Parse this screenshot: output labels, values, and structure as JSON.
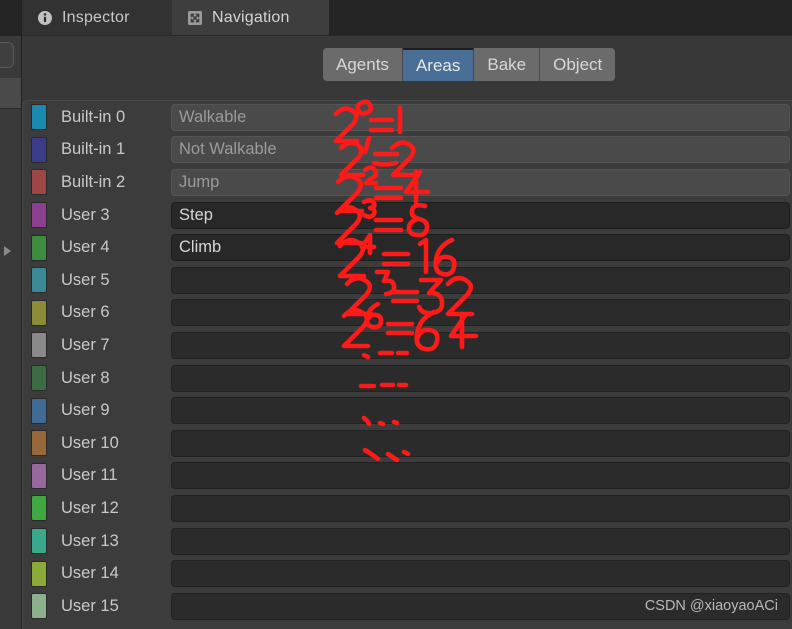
{
  "window": {
    "background_color": "#383838",
    "panel_color": "#3c3c3c"
  },
  "tabs": [
    {
      "label": "Inspector",
      "icon": "info-icon",
      "active": false
    },
    {
      "label": "Navigation",
      "icon": "move-arrows-icon",
      "active": true
    }
  ],
  "toolbar": {
    "buttons": [
      {
        "label": "Agents",
        "active": false
      },
      {
        "label": "Areas",
        "active": true
      },
      {
        "label": "Bake",
        "active": false
      },
      {
        "label": "Object",
        "active": false
      }
    ],
    "active_color": "#4a6f96",
    "inactive_color": "#6b6b6b"
  },
  "areas": [
    {
      "name": "Built-in 0",
      "color": "#1b8ab0",
      "value": "Walkable",
      "editable": false,
      "note": "2⁰ = 1"
    },
    {
      "name": "Built-in 1",
      "color": "#3c3c8c",
      "value": "Not Walkable",
      "editable": false,
      "note": "2¹ = 2"
    },
    {
      "name": "Built-in 2",
      "color": "#9c4646",
      "value": "Jump",
      "editable": false,
      "note": "2² = 4"
    },
    {
      "name": "User 3",
      "color": "#8c3f8c",
      "value": "Step",
      "editable": true,
      "note": "2³ = 8"
    },
    {
      "name": "User 4",
      "color": "#3d8c40",
      "value": "Climb",
      "editable": true,
      "note": "2⁴ = 16"
    },
    {
      "name": "User 5",
      "color": "#3a8a96",
      "value": "",
      "editable": true,
      "note": "2⁵ = 32"
    },
    {
      "name": "User 6",
      "color": "#8c8c38",
      "value": "",
      "editable": true,
      "note": "2⁶ = 64"
    },
    {
      "name": "User 7",
      "color": "#8a8a8a",
      "value": "",
      "editable": true,
      "note": "dashes"
    },
    {
      "name": "User 8",
      "color": "#3d6b42",
      "value": "",
      "editable": true,
      "note": "dashes"
    },
    {
      "name": "User 9",
      "color": "#3f6b96",
      "value": "",
      "editable": true,
      "note": "dashes"
    },
    {
      "name": "User 10",
      "color": "#96683a",
      "value": "",
      "editable": true,
      "note": "dashes"
    },
    {
      "name": "User 11",
      "color": "#96689c",
      "value": "",
      "editable": true,
      "note": ""
    },
    {
      "name": "User 12",
      "color": "#3fa83f",
      "value": "",
      "editable": true,
      "note": ""
    },
    {
      "name": "User 13",
      "color": "#3aa88c",
      "value": "",
      "editable": true,
      "note": ""
    },
    {
      "name": "User 14",
      "color": "#8caa3a",
      "value": "",
      "editable": true,
      "note": ""
    },
    {
      "name": "User 15",
      "color": "#8cb08c",
      "value": "",
      "editable": true,
      "note": ""
    }
  ],
  "annotations": {
    "color": "#ff1a1a",
    "items": [
      "2⁰ = 1",
      "2¹ = 2",
      "2² = 4",
      "2³ = 8",
      "2⁴ = 16",
      "2⁵ = 32",
      "2⁶ = 64"
    ]
  },
  "watermark": {
    "text": "CSDN @xiaoyaoACi"
  }
}
